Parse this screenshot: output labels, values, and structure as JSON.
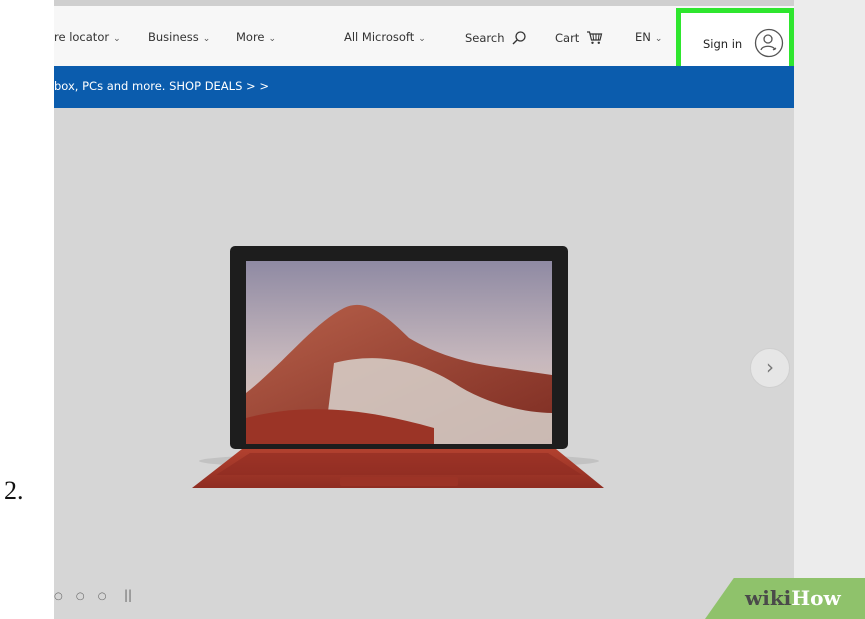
{
  "step_number": "2.",
  "nav": {
    "store_locator": "re locator",
    "business": "Business",
    "more": "More",
    "all_microsoft": "All Microsoft",
    "search": "Search",
    "cart": "Cart",
    "language": "EN",
    "sign_in": "Sign in",
    "chevron": "⌄"
  },
  "banner": {
    "text": "box, PCs and more. SHOP DEALS >  >"
  },
  "hero": {
    "next_arrow": "›",
    "dots": "○ ○ ○",
    "pause": "||"
  },
  "watermark": {
    "wiki": "wiki",
    "how": "How"
  },
  "icons": {
    "search": "search-icon",
    "cart": "cart-icon",
    "avatar": "user-avatar-icon"
  },
  "colors": {
    "highlight": "#2ee62e",
    "banner": "#0b5cad",
    "hero_background": "#d6d6d6",
    "keyboard": "#a9392c"
  }
}
